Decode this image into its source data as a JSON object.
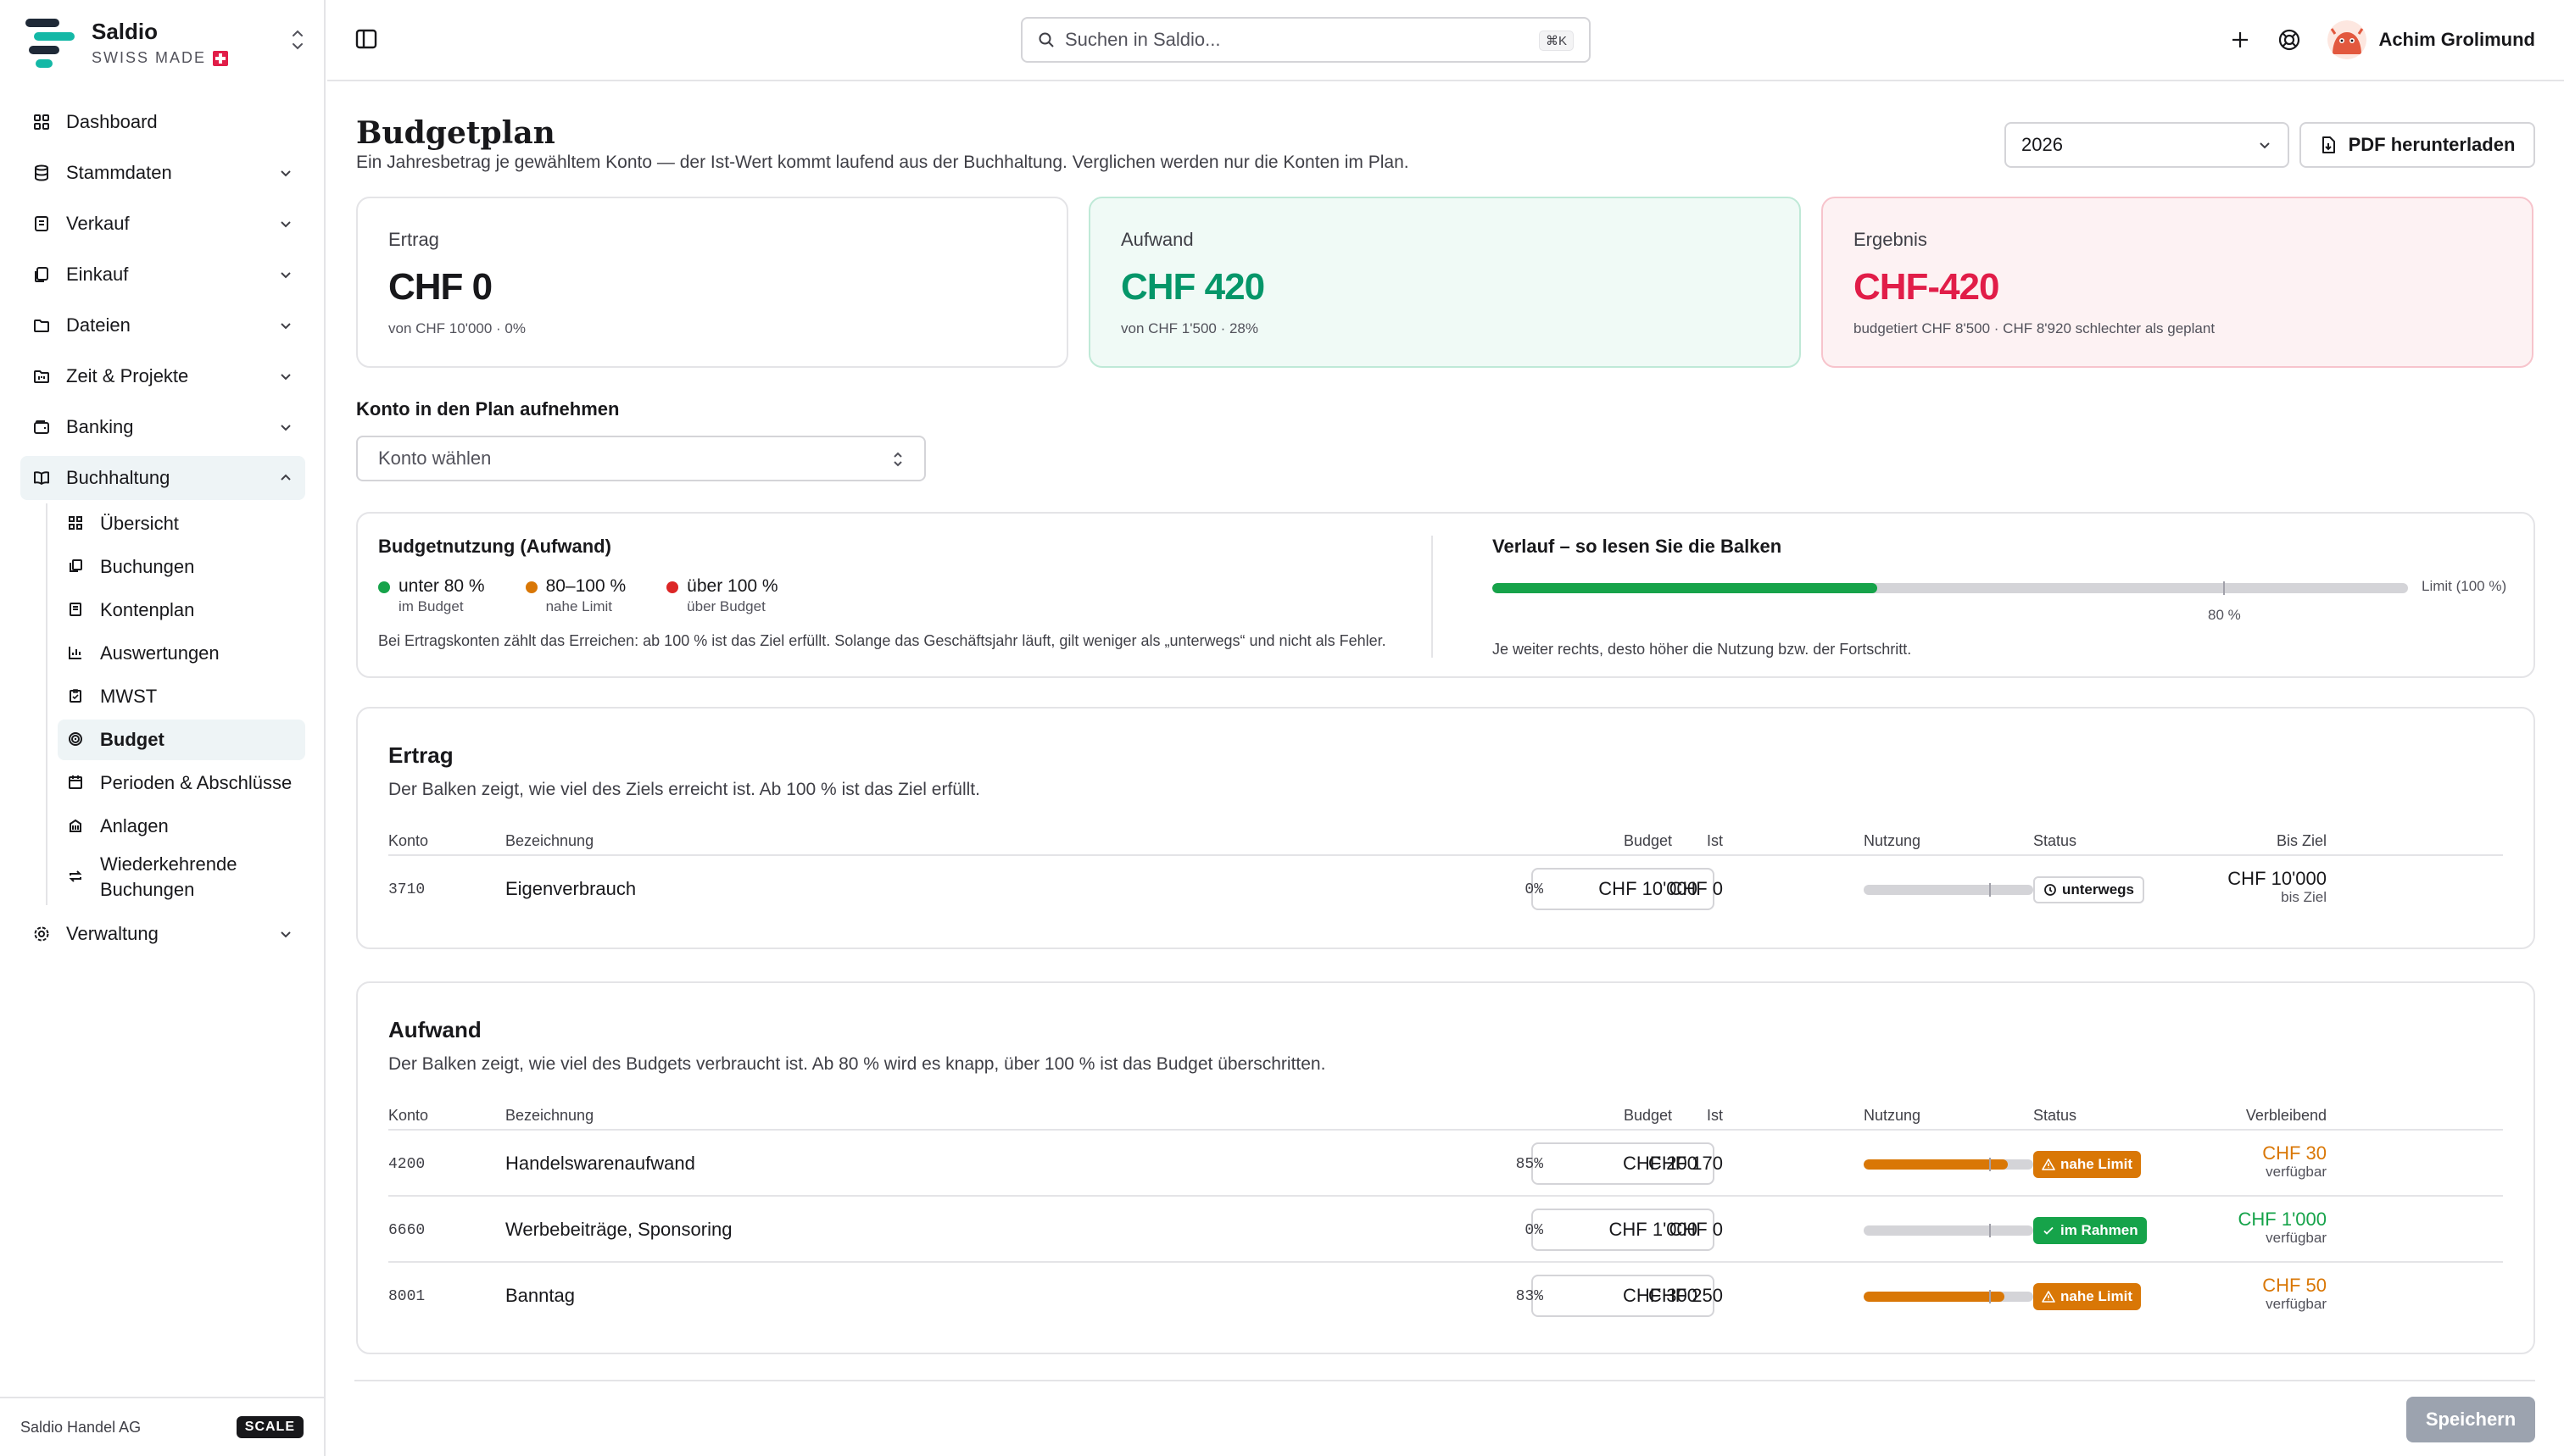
{
  "app": {
    "name": "Saldio",
    "tagline": "SWISS MADE"
  },
  "sidebar": {
    "items": [
      {
        "label": "Dashboard"
      },
      {
        "label": "Stammdaten"
      },
      {
        "label": "Verkauf"
      },
      {
        "label": "Einkauf"
      },
      {
        "label": "Dateien"
      },
      {
        "label": "Zeit & Projekte"
      },
      {
        "label": "Banking"
      },
      {
        "label": "Buchhaltung"
      },
      {
        "label": "Verwaltung"
      }
    ],
    "sub_items": [
      {
        "label": "Übersicht"
      },
      {
        "label": "Buchungen"
      },
      {
        "label": "Kontenplan"
      },
      {
        "label": "Auswertungen"
      },
      {
        "label": "MWST"
      },
      {
        "label": "Budget"
      },
      {
        "label": "Perioden & Abschlüsse"
      },
      {
        "label": "Anlagen"
      },
      {
        "label": "Wiederkehrende Buchungen"
      }
    ],
    "company": "Saldio Handel AG",
    "plan": "SCALE"
  },
  "topbar": {
    "search_placeholder": "Suchen in Saldio...",
    "shortcut": "⌘K",
    "user_name": "Achim Grolimund"
  },
  "page": {
    "title": "Budgetplan",
    "description": "Ein Jahresbetrag je gewähltem Konto — der Ist-Wert kommt laufend aus der Buchhaltung. Verglichen werden nur die Konten im Plan.",
    "year": "2026",
    "pdf_label": "PDF herunterladen"
  },
  "kpis": {
    "ertrag": {
      "label": "Ertrag",
      "value": "CHF 0",
      "sub": "von CHF 10'000 · 0%"
    },
    "aufwand": {
      "label": "Aufwand",
      "value": "CHF 420",
      "sub": "von CHF 1'500 · 28%"
    },
    "ergebnis": {
      "label": "Ergebnis",
      "value": "CHF-420",
      "sub": "budgetiert CHF 8'500 · CHF 8'920 schlechter als geplant"
    }
  },
  "add_account": {
    "label": "Konto in den Plan aufnehmen",
    "placeholder": "Konto wählen"
  },
  "legend": {
    "title": "Budgetnutzung (Aufwand)",
    "items": [
      {
        "label": "unter 80 %",
        "sub": "im Budget",
        "color": "#16a34a"
      },
      {
        "label": "80–100 %",
        "sub": "nahe Limit",
        "color": "#d97706"
      },
      {
        "label": "über 100 %",
        "sub": "über Budget",
        "color": "#dc2626"
      }
    ],
    "note": "Bei Ertragskonten zählt das Erreichen: ab 100 % ist das Ziel erfüllt. Solange das Geschäftsjahr läuft, gilt weniger als „unterwegs“ und nicht als Fehler.",
    "demo_title": "Verlauf – so lesen Sie die Balken",
    "demo_fill": 0.42,
    "demo_limit": "Limit (100 %)",
    "demo_marker": "80 %",
    "demo_note": "Je weiter rechts, desto höher die Nutzung bzw. der Fortschritt."
  },
  "ertrag": {
    "title": "Ertrag",
    "description": "Der Balken zeigt, wie viel des Ziels erreicht ist. Ab 100 % ist das Ziel erfüllt.",
    "headers": {
      "konto": "Konto",
      "bez": "Bezeichnung",
      "budget": "Budget",
      "ist": "Ist",
      "nutzung": "Nutzung",
      "ziel": "Bis Ziel",
      "status": "Status"
    },
    "rows": [
      {
        "konto": "3710",
        "bez": "Eigenverbrauch",
        "budget": "CHF 10'000",
        "ist": "CHF 0",
        "pct": "0%",
        "fill": 0,
        "rest": "CHF 10'000",
        "rest_sub": "bis Ziel",
        "status": "unterwegs"
      }
    ]
  },
  "aufwand": {
    "title": "Aufwand",
    "description": "Der Balken zeigt, wie viel des Budgets verbraucht ist. Ab 80 % wird es knapp, über 100 % ist das Budget überschritten.",
    "headers": {
      "konto": "Konto",
      "bez": "Bezeichnung",
      "budget": "Budget",
      "ist": "Ist",
      "nutzung": "Nutzung",
      "rest": "Verbleibend",
      "status": "Status"
    },
    "rows": [
      {
        "konto": "4200",
        "bez": "Handelswarenaufwand",
        "budget": "CHF 200",
        "ist": "CHF 170",
        "pct": "85%",
        "fill": 0.85,
        "rest": "CHF 30",
        "rest_sub": "verfügbar",
        "status": "nahe Limit"
      },
      {
        "konto": "6660",
        "bez": "Werbebeiträge, Sponsoring",
        "budget": "CHF 1'000",
        "ist": "CHF 0",
        "pct": "0%",
        "fill": 0,
        "rest": "CHF 1'000",
        "rest_sub": "verfügbar",
        "status": "im Rahmen"
      },
      {
        "konto": "8001",
        "bez": "Banntag",
        "budget": "CHF 300",
        "ist": "CHF 250",
        "pct": "83%",
        "fill": 0.83,
        "rest": "CHF 50",
        "rest_sub": "verfügbar",
        "status": "nahe Limit"
      }
    ]
  },
  "save_label": "Speichern"
}
